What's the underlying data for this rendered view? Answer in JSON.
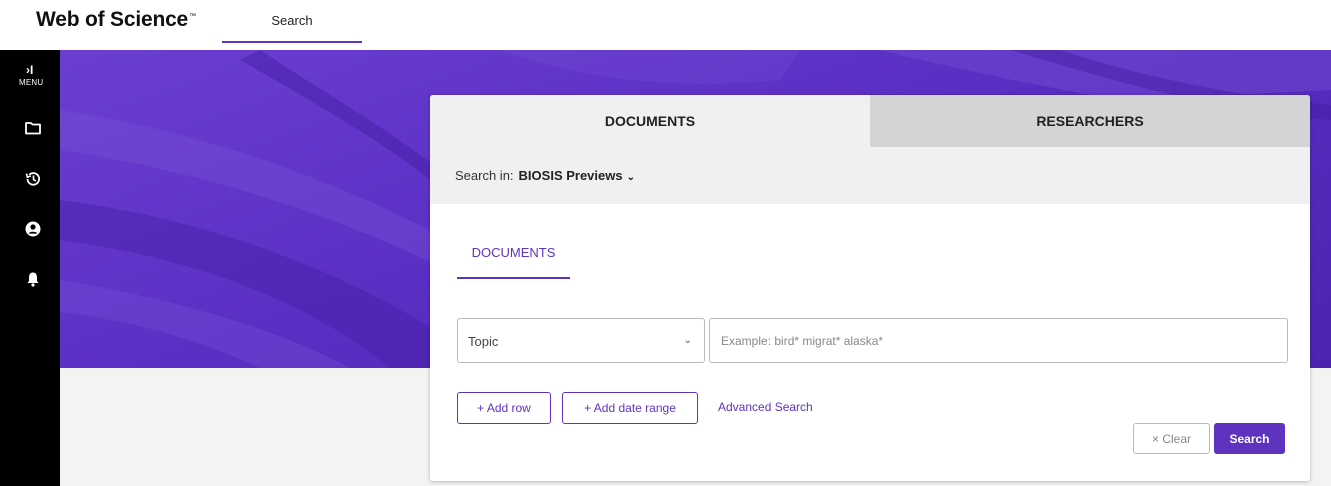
{
  "app": {
    "logo_text": "Web of Science",
    "logo_mark": "™"
  },
  "top_nav": {
    "search_tab": "Search"
  },
  "sidebar": {
    "menu_chevron": "›I",
    "menu_label": "MENU",
    "icons": [
      "folder-icon",
      "history-icon",
      "user-icon",
      "bell-icon"
    ]
  },
  "search_card": {
    "tabs": {
      "documents": "DOCUMENTS",
      "researchers": "RESEARCHERS"
    },
    "search_in_label": "Search in:",
    "database": "BIOSIS Previews",
    "database_caret": "⌄",
    "sub_tab": "DOCUMENTS",
    "field_select": {
      "value": "Topic",
      "chevron": "⌄"
    },
    "query_input": {
      "value": "",
      "placeholder": "Example: bird* migrat* alaska*"
    },
    "add_row_label": "+ Add row",
    "add_date_range_label": "+ Add date range",
    "advanced_search_label": "Advanced Search",
    "clear_label": "× Clear",
    "search_label": "Search"
  },
  "colors": {
    "accent": "#5e33bf",
    "hero": "#5a2fc4",
    "sidebar": "#000000"
  }
}
